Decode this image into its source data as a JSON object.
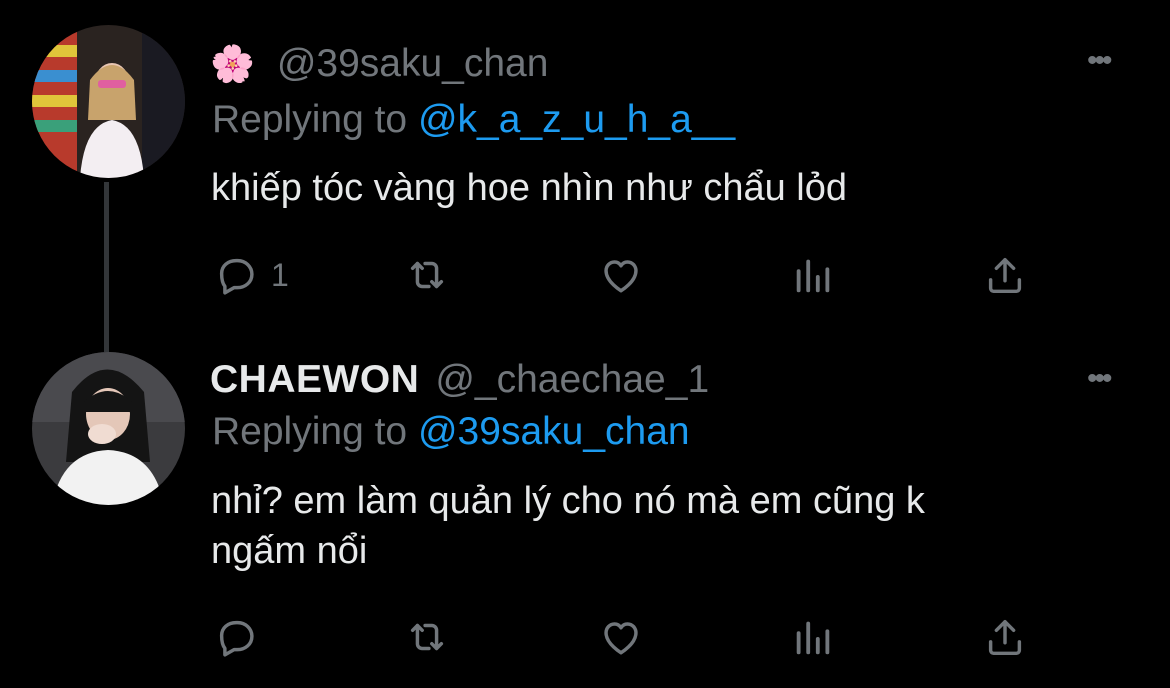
{
  "tweets": [
    {
      "display_name": "",
      "flower": "🌸",
      "handle": "@39saku_chan",
      "replying_prefix": "Replying to",
      "replying_to": "@k_a_z_u_h_a__",
      "text": "khiếp tóc vàng hoe nhìn như chẩu lỏd",
      "reply_count": "1",
      "more": "•••"
    },
    {
      "display_name": "CHAEWON",
      "handle": "@_chaechae_1",
      "replying_prefix": "Replying to",
      "replying_to": "@39saku_chan",
      "text_line1": "nhỉ? em làm quản lý cho nó mà em cũng k",
      "text_line2": "ngấm nổi",
      "reply_count": "",
      "more": "•••"
    }
  ],
  "colors": {
    "background": "#000000",
    "text": "#e7e9ea",
    "secondary": "#71767b",
    "link": "#1d9bf0"
  },
  "icons": [
    "reply-icon",
    "retweet-icon",
    "like-icon",
    "analytics-icon",
    "share-icon",
    "more-icon"
  ]
}
